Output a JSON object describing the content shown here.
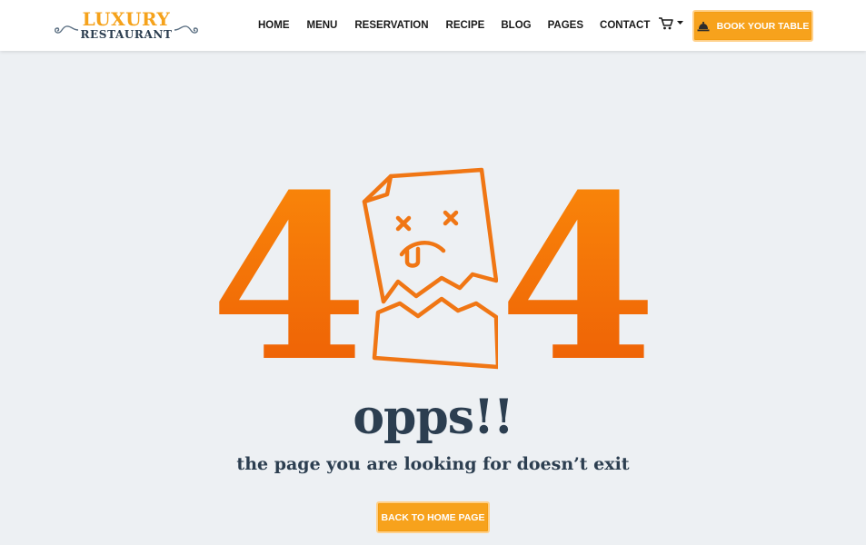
{
  "brand": {
    "top": "LUXURY",
    "bottom": "RESTAURANT"
  },
  "nav": {
    "items": [
      {
        "label": "HOME"
      },
      {
        "label": "MENU"
      },
      {
        "label": "RESERVATION"
      },
      {
        "label": "RECIPE"
      },
      {
        "label": "BLOG"
      },
      {
        "label": "PAGES"
      },
      {
        "label": "CONTACT"
      }
    ]
  },
  "header": {
    "cart_icon": "cart-icon",
    "book_label": "BOOK YOUR TABLE",
    "book_icon": "bell-icon"
  },
  "error": {
    "digit_left": "4",
    "digit_right": "4",
    "heading": "opps!!",
    "message": "the page you are looking for doesn’t exit",
    "button_label": "BACK TO HOME PAGE"
  },
  "colors": {
    "accent": "#f7a21c",
    "orange_top": "#fb8c0a",
    "orange_bottom": "#ec5a05",
    "text_dark": "#2c3e50",
    "background": "#edf0f3"
  }
}
